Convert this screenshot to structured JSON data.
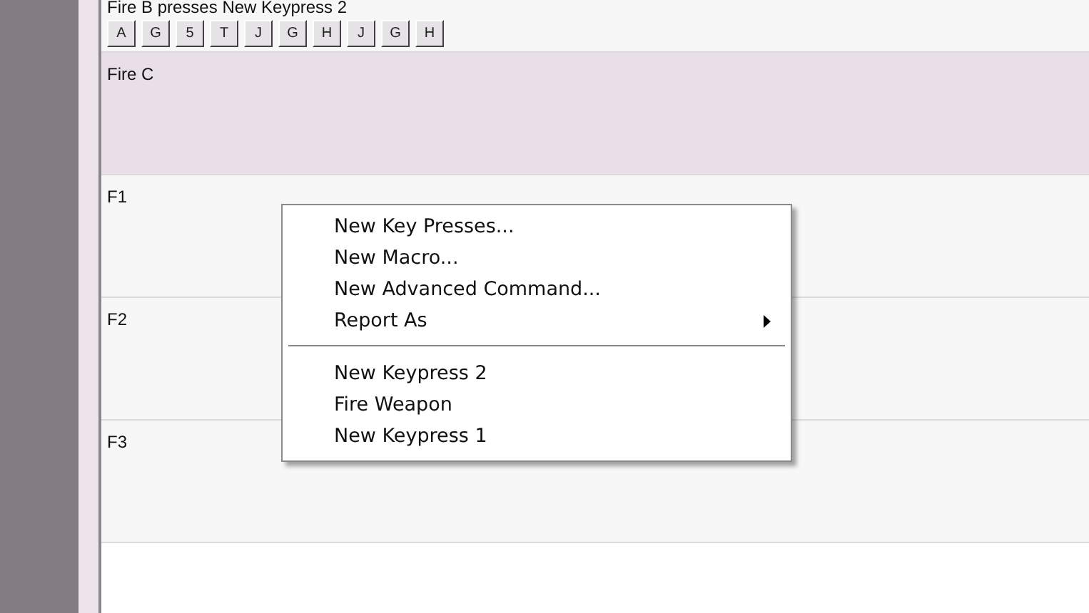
{
  "bindings": [
    {
      "name": "Fire B presses New Keypress 2",
      "keys": [
        "A",
        "G",
        "5",
        "T",
        "J",
        "G",
        "H",
        "J",
        "G",
        "H"
      ],
      "selected": false
    },
    {
      "name": "Fire C",
      "selected": true
    },
    {
      "name": "F1",
      "selected": false
    },
    {
      "name": "F2",
      "selected": false
    },
    {
      "name": "F3",
      "selected": false
    }
  ],
  "context_menu": {
    "items": [
      {
        "kind": "item",
        "label": "New Key Presses..."
      },
      {
        "kind": "item",
        "label": "New Macro..."
      },
      {
        "kind": "item",
        "label": "New Advanced Command..."
      },
      {
        "kind": "submenu",
        "label": "Report As"
      },
      {
        "kind": "separator"
      },
      {
        "kind": "item",
        "label": "New Keypress 2"
      },
      {
        "kind": "item",
        "label": "Fire Weapon"
      },
      {
        "kind": "item",
        "label": "New Keypress 1"
      }
    ]
  }
}
